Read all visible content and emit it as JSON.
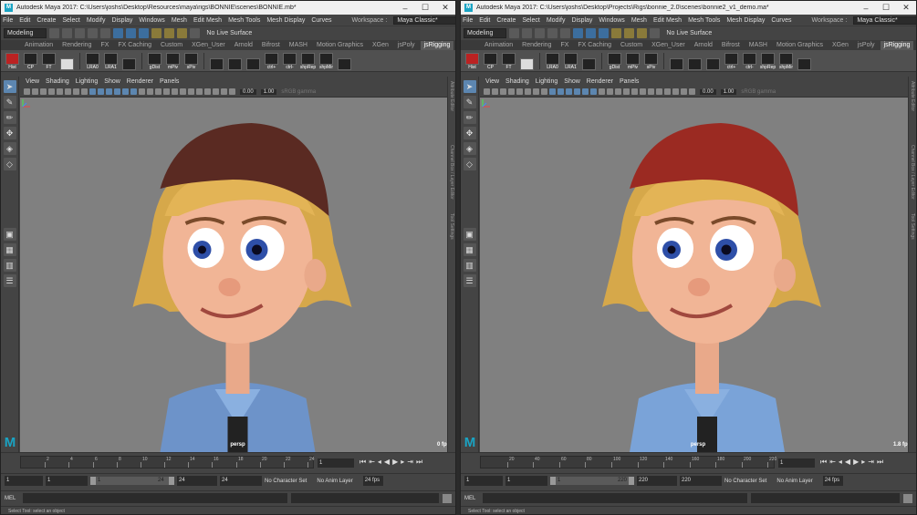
{
  "windows": [
    {
      "title": "Autodesk Maya 2017: C:\\Users\\joshs\\Desktop\\Resources\\maya\\rigs\\BONNIE\\scenes\\BONNIE.mb*",
      "menus": [
        "File",
        "Edit",
        "Create",
        "Select",
        "Modify",
        "Display",
        "Windows",
        "Mesh",
        "Edit Mesh",
        "Mesh Tools",
        "Mesh Display",
        "Curves"
      ],
      "workspace_label": "Workspace :",
      "workspace_value": "Maya Classic*",
      "mode": "Modeling",
      "live_surface": "No Live Surface",
      "shelf_tabs": [
        "Animation",
        "Rendering",
        "FX",
        "FX Caching",
        "Custom",
        "XGen_User",
        "Arnold",
        "Bifrost",
        "MASH",
        "Motion Graphics",
        "XGen",
        "jsPoly",
        "jsRigging"
      ],
      "active_shelf_tab": "jsRigging",
      "shelf_buttons": [
        "Hist",
        "CP",
        "FT",
        "",
        "LRA0",
        "LRA1",
        "",
        "gDist",
        "mPiv",
        "sPiv",
        "",
        "",
        "",
        "ctrl+",
        "ctrl-",
        "shpRep",
        "shpMir",
        ""
      ],
      "panel_menus": [
        "View",
        "Shading",
        "Lighting",
        "Show",
        "Renderer",
        "Panels"
      ],
      "exposure": "0.00",
      "gamma": "1.00",
      "color_space": "sRGB gamma",
      "camera": "persp",
      "fps": "0 fps",
      "timeline_ticks": [
        "2",
        "4",
        "6",
        "8",
        "10",
        "12",
        "14",
        "16",
        "18",
        "20",
        "22",
        "24"
      ],
      "current_frame": "1",
      "range": {
        "start": "1",
        "anim_start": "1",
        "slider_start": "1",
        "slider_end": "24",
        "end": "24",
        "anim_end": "24"
      },
      "character_set": "No Character Set",
      "anim_layer": "No Anim Layer",
      "playback_fps": "24 fps",
      "mel_label": "MEL",
      "help_line": "Select Tool: select an object",
      "side_tabs": [
        "Attribute Editor",
        "Channel Box / Layer Editor",
        "Tool Settings"
      ],
      "hat_color": "#5a2a22",
      "shirt_color": "#6d93c9"
    },
    {
      "title": "Autodesk Maya 2017: C:\\Users\\joshs\\Desktop\\Projects\\Rigs\\bonnie_2.0\\scenes\\bonnie2_v1_demo.ma*",
      "menus": [
        "File",
        "Edit",
        "Create",
        "Select",
        "Modify",
        "Display",
        "Windows",
        "Mesh",
        "Edit Mesh",
        "Mesh Tools",
        "Mesh Display",
        "Curves"
      ],
      "workspace_label": "Workspace :",
      "workspace_value": "Maya Classic*",
      "mode": "Modeling",
      "live_surface": "No Live Surface",
      "shelf_tabs": [
        "Animation",
        "Rendering",
        "FX",
        "FX Caching",
        "Custom",
        "XGen_User",
        "Arnold",
        "Bifrost",
        "MASH",
        "Motion Graphics",
        "XGen",
        "jsPoly",
        "jsRigging"
      ],
      "active_shelf_tab": "jsRigging",
      "shelf_buttons": [
        "Hist",
        "CP",
        "FT",
        "",
        "LRA0",
        "LRA1",
        "",
        "gDist",
        "mPiv",
        "sPiv",
        "",
        "",
        "",
        "ctrl+",
        "ctrl-",
        "shpRep",
        "shpMir",
        ""
      ],
      "panel_menus": [
        "View",
        "Shading",
        "Lighting",
        "Show",
        "Renderer",
        "Panels"
      ],
      "exposure": "0.00",
      "gamma": "1.00",
      "color_space": "sRGB gamma",
      "camera": "persp",
      "fps": "1.8 fps",
      "timeline_ticks": [
        "20",
        "40",
        "60",
        "80",
        "100",
        "120",
        "140",
        "160",
        "180",
        "200",
        "220"
      ],
      "current_frame": "1",
      "range": {
        "start": "1",
        "anim_start": "1",
        "slider_start": "1",
        "slider_end": "220",
        "end": "220",
        "anim_end": "220"
      },
      "character_set": "No Character Set",
      "anim_layer": "No Anim Layer",
      "playback_fps": "24 fps",
      "mel_label": "MEL",
      "help_line": "Select Tool: select an object",
      "side_tabs": [
        "Attribute Editor",
        "Channel Box / Layer Editor",
        "Tool Settings"
      ],
      "hat_color": "#9b2a22",
      "shirt_color": "#7aa3d8"
    }
  ]
}
